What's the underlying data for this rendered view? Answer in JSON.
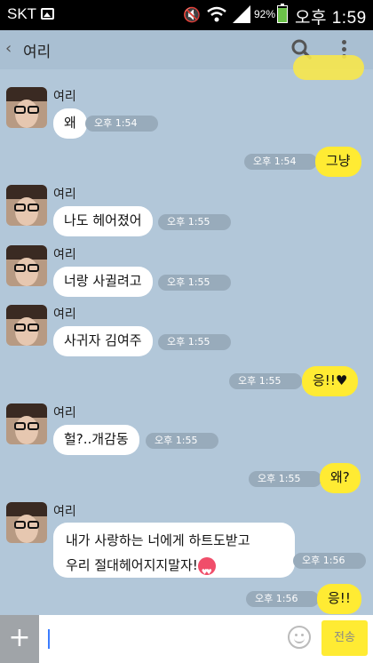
{
  "status_bar": {
    "carrier": "SKT",
    "battery_percent": "92%",
    "time": "오후 1:59"
  },
  "header": {
    "title": "여리"
  },
  "messages": [
    {
      "sender": "여리",
      "text": "왜",
      "time": "오후 1:54"
    },
    {
      "me": true,
      "text": "그냥",
      "time": "오후 1:54"
    },
    {
      "sender": "여리",
      "text": "나도 헤어졌어",
      "time": "오후 1:55"
    },
    {
      "sender": "여리",
      "text": "너랑 사귈려고",
      "time": "오후 1:55"
    },
    {
      "sender": "여리",
      "text": "사귀자 김여주",
      "time": "오후 1:55"
    },
    {
      "me": true,
      "text": "응!!",
      "time": "오후 1:55"
    },
    {
      "sender": "여리",
      "text": "헐?..개감동",
      "time": "오후 1:55"
    },
    {
      "me": true,
      "text": "왜?",
      "time": "오후 1:55"
    },
    {
      "sender": "여리",
      "text_line1": "내가 사랑하는 너에게 하트도받고",
      "text_line2": "우리 절대헤어지지말자!",
      "time": "오후 1:56"
    },
    {
      "me": true,
      "text": "응!!",
      "time": "오후 1:56"
    }
  ],
  "input_bar": {
    "send_label": "전송"
  },
  "colors": {
    "chat_bg": "#b2c7d9",
    "my_bubble": "#ffeb33",
    "their_bubble": "#ffffff"
  }
}
